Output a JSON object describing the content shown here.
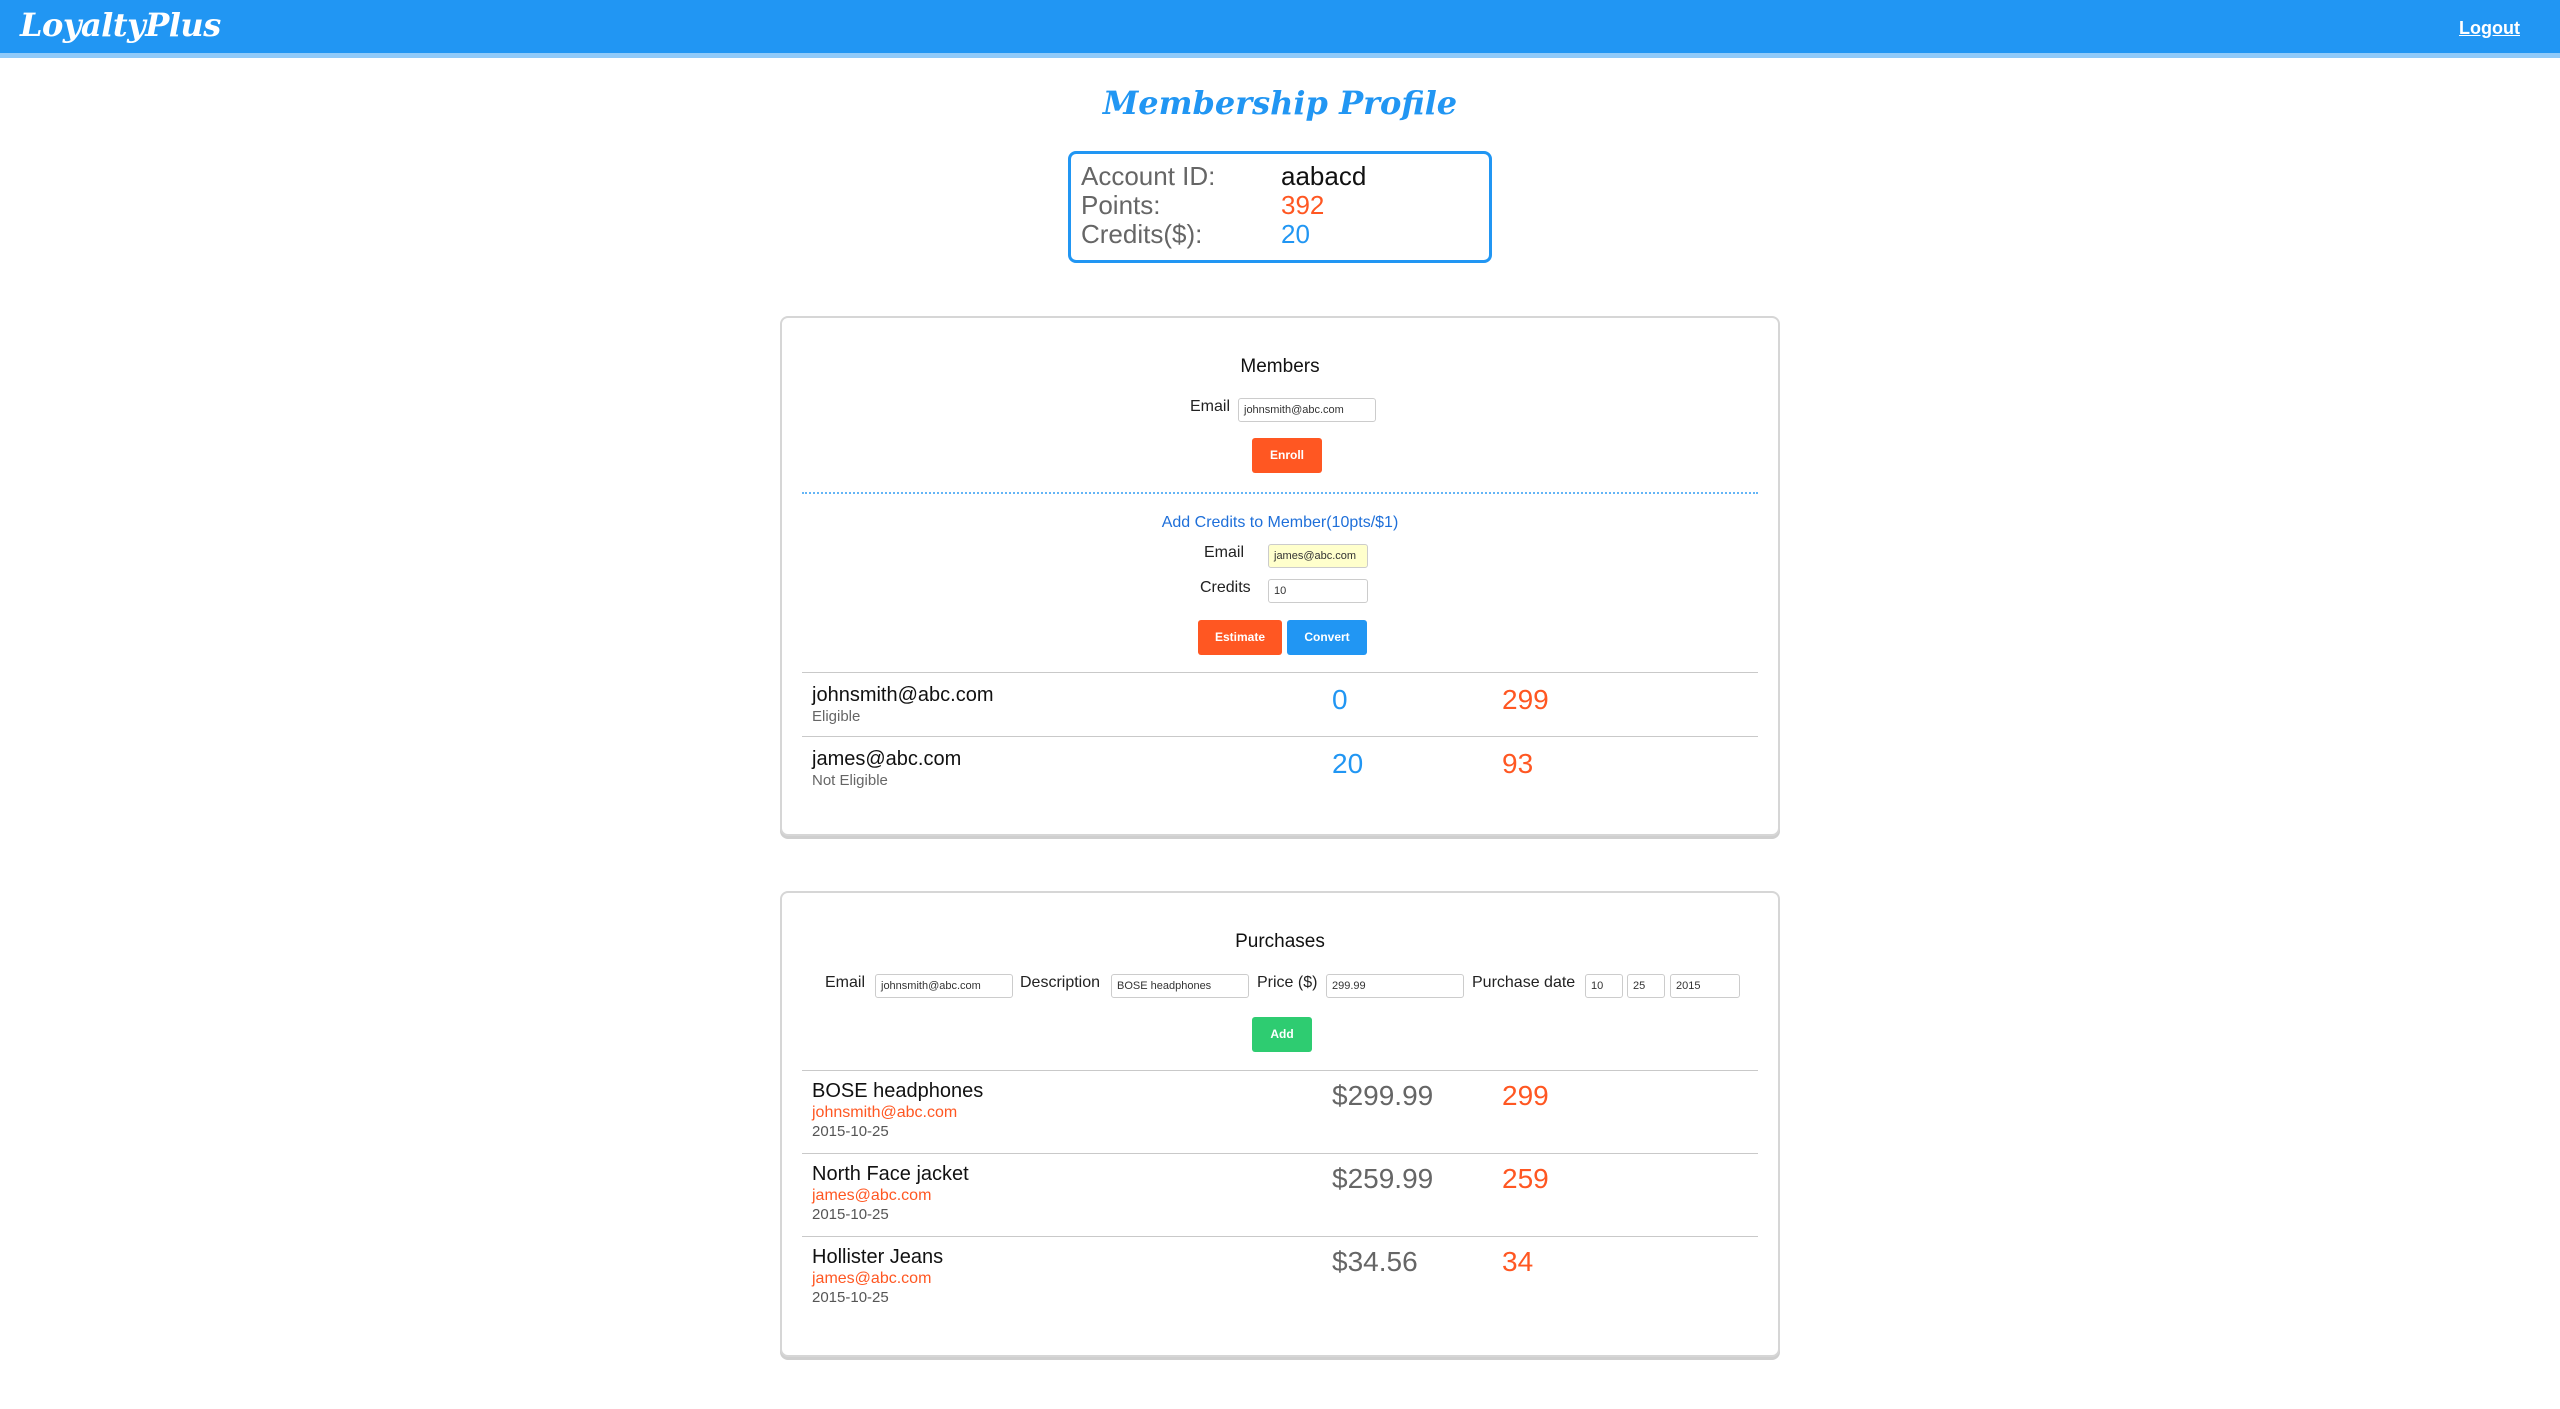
{
  "header": {
    "brand": "LoyaltyPlus",
    "logout": "Logout"
  },
  "page_title": "Membership Profile",
  "account": {
    "id_label": "Account ID:",
    "id_value": "aabacd",
    "points_label": "Points:",
    "points_value": "392",
    "credits_label": "Credits($):",
    "credits_value": "20"
  },
  "members": {
    "title": "Members",
    "email_label": "Email",
    "email_value": "johnsmith@abc.com",
    "enroll_label": "Enroll",
    "add_credits_title": "Add Credits to Member(10pts/$1)",
    "credit_email_label": "Email",
    "credit_email_value": "james@abc.com",
    "credits_label": "Credits",
    "credits_value": "10",
    "estimate_label": "Estimate",
    "convert_label": "Convert",
    "rows": [
      {
        "email": "johnsmith@abc.com",
        "status": "Eligible",
        "credits": "0",
        "points": "299"
      },
      {
        "email": "james@abc.com",
        "status": "Not Eligible",
        "credits": "20",
        "points": "93"
      }
    ]
  },
  "purchases": {
    "title": "Purchases",
    "email_label": "Email",
    "email_value": "johnsmith@abc.com",
    "description_label": "Description",
    "description_value": "BOSE headphones",
    "price_label": "Price ($)",
    "price_value": "299.99",
    "date_label": "Purchase date",
    "month_value": "10",
    "day_value": "25",
    "year_value": "2015",
    "add_label": "Add",
    "rows": [
      {
        "description": "BOSE headphones",
        "email": "johnsmith@abc.com",
        "date": "2015-10-25",
        "price": "$299.99",
        "points": "299"
      },
      {
        "description": "North Face jacket",
        "email": "james@abc.com",
        "date": "2015-10-25",
        "price": "$259.99",
        "points": "259"
      },
      {
        "description": "Hollister Jeans",
        "email": "james@abc.com",
        "date": "2015-10-25",
        "price": "$34.56",
        "points": "34"
      }
    ]
  },
  "colors": {
    "primary": "#2196F3",
    "accent": "#FF5722",
    "success": "#2ECC71"
  }
}
